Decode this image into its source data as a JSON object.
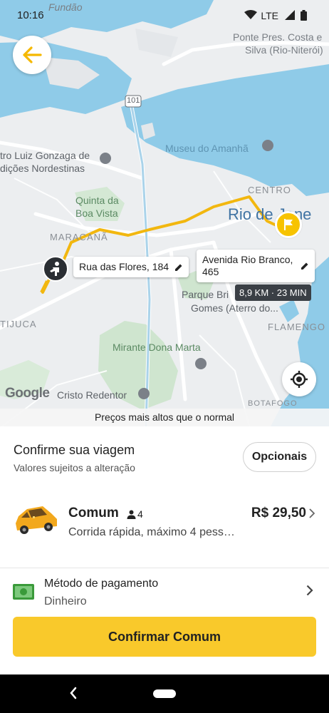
{
  "status_bar": {
    "time": "10:16",
    "network": "LTE"
  },
  "map": {
    "labels": {
      "fundao": "Fundão",
      "ponte": "Ponte Pres. Costa e",
      "ponte2": "Silva (Rio-Niterói)",
      "highway": "101",
      "museu_amanha": "Museu do Amanhã",
      "luiz_gonzaga": "tro Luiz Gonzaga de",
      "luiz_gonzaga2": "dições Nordestinas",
      "quinta": "Quinta da",
      "quinta2": "Boa Vista",
      "centro": "CENTRO",
      "rio": "Rio de Jane",
      "maracana": "MARACANÃ",
      "parque": "Parque Bri",
      "parque2": "Gomes (Aterro do...",
      "tijuca": "TIJUCA",
      "flamengo": "FLAMENGO",
      "mirante": "Mirante Dona Marta",
      "cristo": "Cristo Redentor",
      "botafogo": "BOTAFOGO"
    },
    "origin_address": "Rua das Flores, 184",
    "destination_address_line1": "Avenida Rio Branco,",
    "destination_address_line2": "465",
    "eta": "8,9 KM · 23 MIN",
    "google_logo": "Google",
    "price_notice": "Preços mais altos que o normal"
  },
  "sheet": {
    "title": "Confirme sua viagem",
    "subtitle": "Valores sujeitos a alteração",
    "options_label": "Opcionais",
    "ride": {
      "name": "Comum",
      "capacity": "4",
      "price": "R$ 29,50",
      "description": "Corrida rápida, máximo 4 pess…"
    },
    "payment": {
      "label": "Método de pagamento",
      "value": "Dinheiro"
    },
    "confirm_label": "Confirmar Comum"
  },
  "colors": {
    "accent": "#f9c92b",
    "water": "#8fcbe8",
    "route": "#f2b70f"
  },
  "icons": [
    "back-arrow-icon",
    "locate-icon",
    "origin-person-icon",
    "destination-flag-icon",
    "edit-pencil-icon",
    "person-icon",
    "chevron-right-icon",
    "cash-icon",
    "car-icon",
    "wifi-icon",
    "signal-icon",
    "battery-icon"
  ]
}
